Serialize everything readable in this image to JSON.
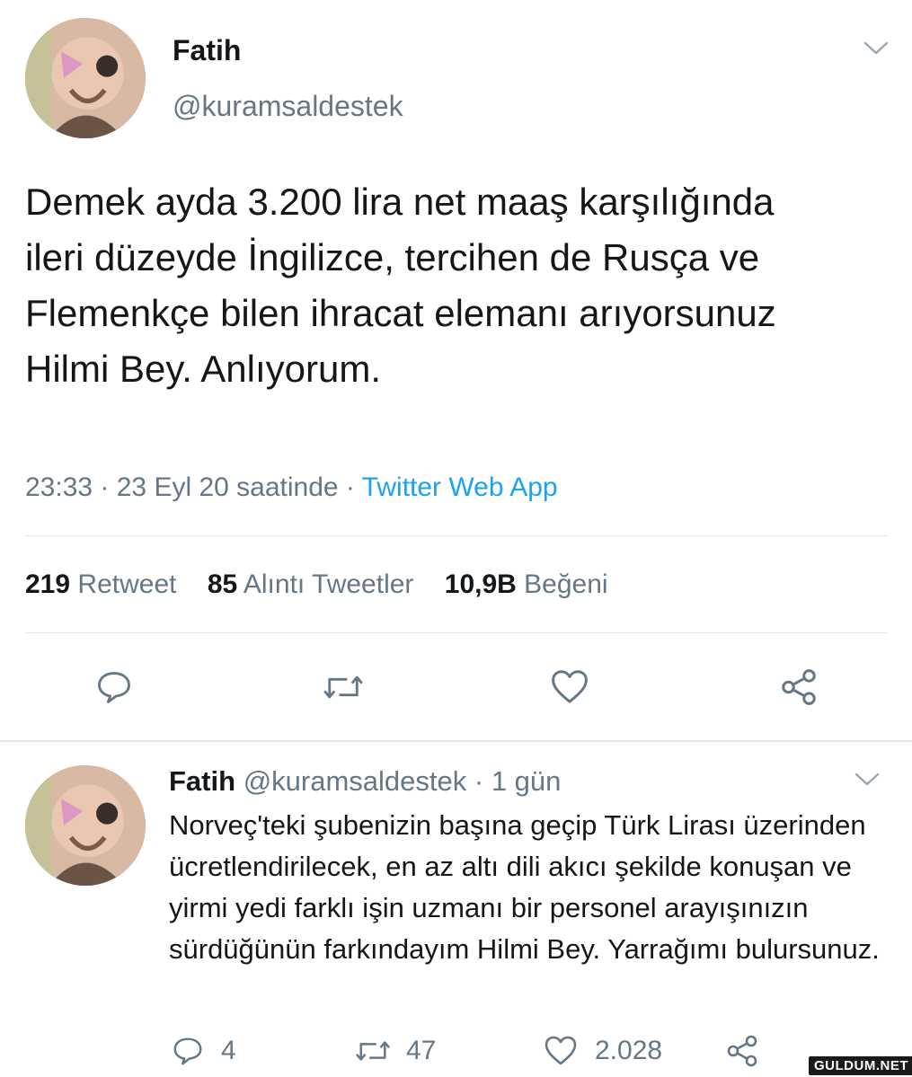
{
  "main_tweet": {
    "author_name": "Fatih",
    "author_handle": "@kuramsaldestek",
    "text": "Demek ayda 3.200 lira net maaş karşılığında ileri düzeyde İngilizce, tercihen de Rusça ve Flemenkçe bilen ihracat elemanı arıyorsunuz Hilmi Bey. Anlıyorum.",
    "time": "23:33 · 23 Eyl 20 saatinde ·",
    "source": "Twitter Web App",
    "stats": {
      "retweet_count": "219",
      "retweet_label": "Retweet",
      "quote_count": "85",
      "quote_label": "Alıntı Tweetler",
      "like_count": "10,9B",
      "like_label": "Beğeni"
    }
  },
  "reply_tweet": {
    "author_name": "Fatih",
    "author_handle": "@kuramsaldestek",
    "time_sep": "·",
    "time": "1 gün",
    "text": "Norveç'teki şubenizin başına geçip Türk Lirası üzerinden ücretlendirilecek, en az altı dili akıcı şekilde konuşan ve yirmi yedi farklı işin uzmanı bir personel arayışınızın sürdüğünün farkındayım Hilmi Bey. Yarrağımı bulursunuz.",
    "reply_count": "4",
    "retweet_count": "47",
    "like_count": "2.028"
  },
  "watermark": "GULDUM.NET",
  "icons": {
    "reply": "reply-icon",
    "retweet": "retweet-icon",
    "like": "heart-icon",
    "share": "share-icon",
    "more": "chevron-down-icon"
  },
  "colors": {
    "text": "#14171a",
    "muted": "#657786",
    "link": "#1da1f2",
    "divider": "#e1e8ed"
  }
}
